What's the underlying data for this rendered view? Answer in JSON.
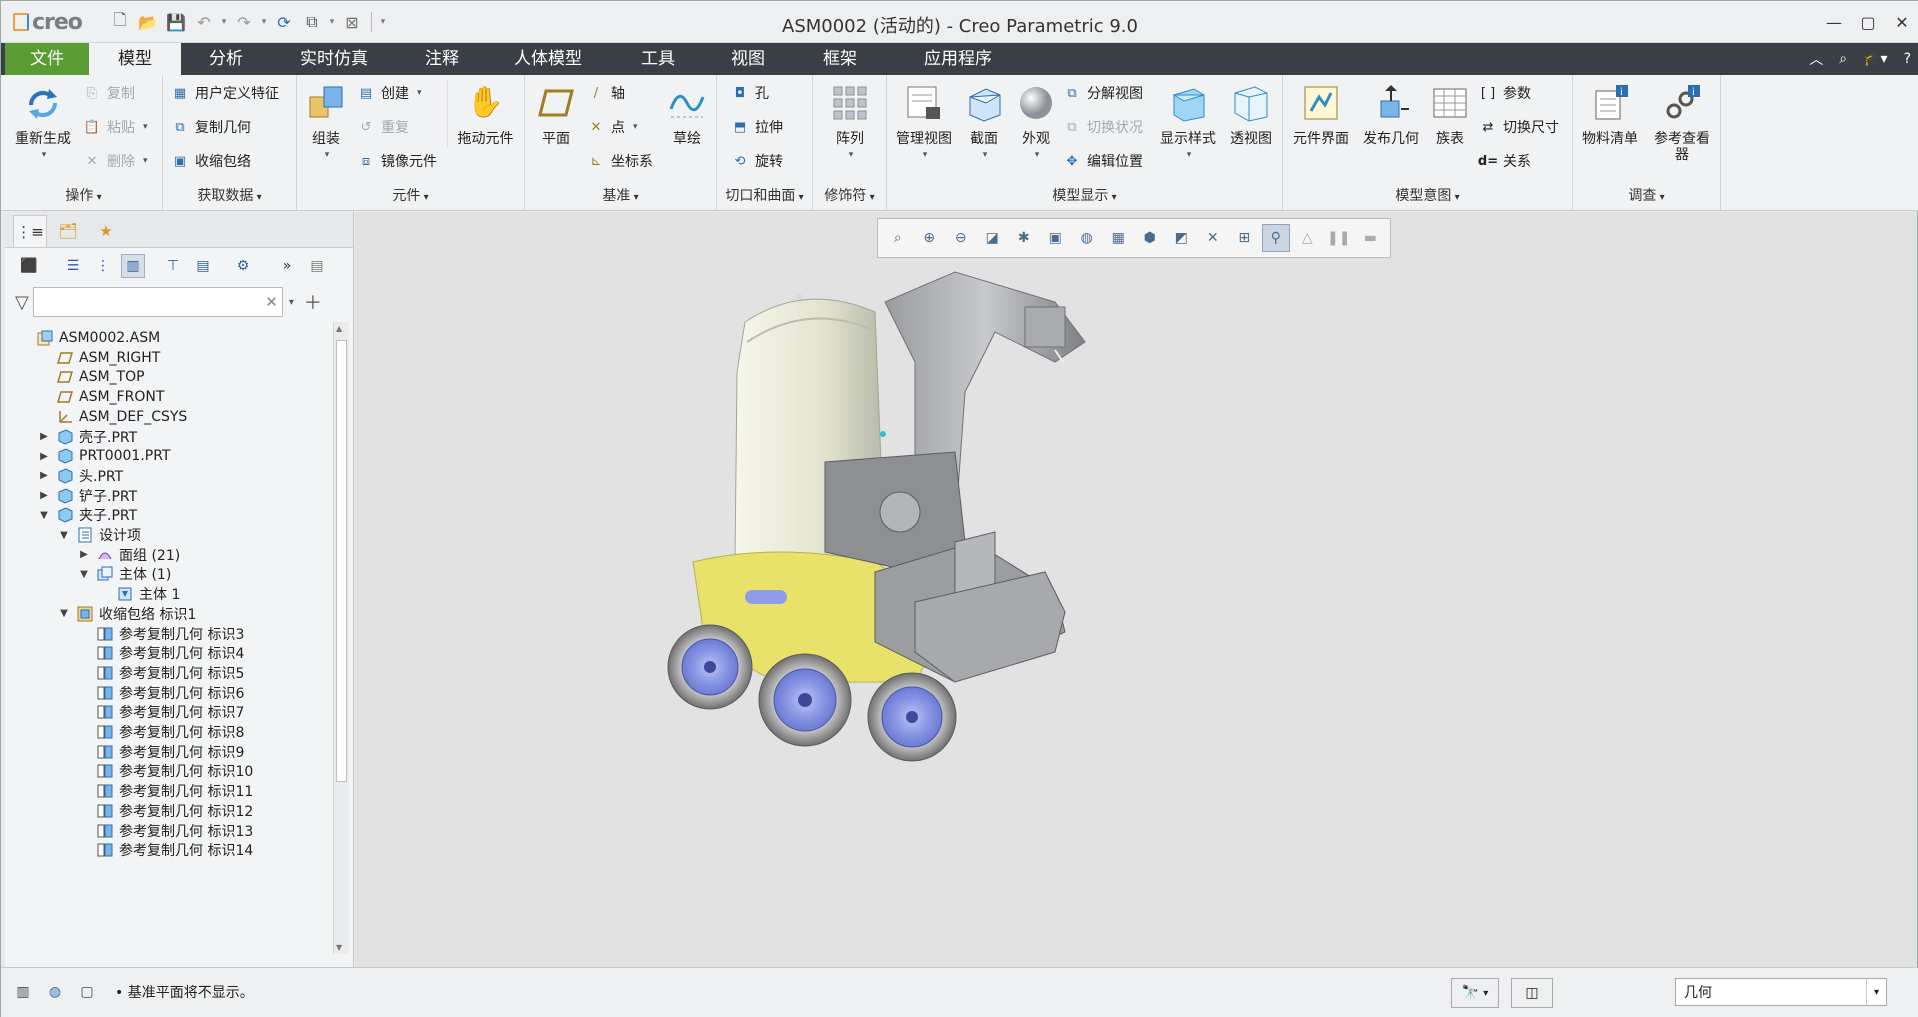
{
  "title_bar": {
    "title": "ASM0002 (活动的) - Creo Parametric 9.0",
    "logo_text": "creo",
    "qat_icons": [
      "new-icon",
      "open-icon",
      "save-icon",
      "undo-icon",
      "redo-icon",
      "regenerate-icon",
      "windows-icon",
      "close-window-icon",
      "customize-icon"
    ]
  },
  "menu_tabs": [
    {
      "label": "文件"
    },
    {
      "label": "模型"
    },
    {
      "label": "分析"
    },
    {
      "label": "实时仿真"
    },
    {
      "label": "注释"
    },
    {
      "label": "人体模型"
    },
    {
      "label": "工具"
    },
    {
      "label": "视图"
    },
    {
      "label": "框架"
    },
    {
      "label": "应用程序"
    }
  ],
  "ribbon": {
    "operations": {
      "label": "操作",
      "regenerate": "重新生成",
      "copy": "复制",
      "paste": "粘贴",
      "delete": "删除"
    },
    "get_data": {
      "label": "获取数据",
      "udf": "用户定义特征",
      "copy_geom": "复制几何",
      "shrinkwrap": "收缩包络"
    },
    "component": {
      "label": "元件",
      "assemble": "组装",
      "create": "创建",
      "repeat": "重复",
      "mirror": "镜像元件",
      "drag": "拖动元件"
    },
    "datum": {
      "label": "基准",
      "plane": "平面",
      "axis": "轴",
      "point": "点",
      "csys": "坐标系",
      "sketch": "草绘"
    },
    "cut_surface": {
      "label": "切口和曲面",
      "hole": "孔",
      "extrude": "拉伸",
      "revolve": "旋转"
    },
    "modifiers": {
      "label": "修饰符",
      "pattern": "阵列"
    },
    "model_display": {
      "label": "模型显示",
      "manage_views": "管理视图",
      "section": "截面",
      "appearance": "外观",
      "explode": "分解视图",
      "toggle_status": "切换状况",
      "edit_position": "编辑位置",
      "display_style": "显示样式",
      "perspective": "透视图"
    },
    "model_intent": {
      "label": "模型意图",
      "comp_interface": "元件界面",
      "publish_geom": "发布几何",
      "family_table": "族表",
      "params": "参数",
      "switch_dims": "切换尺寸",
      "relations": "关系"
    },
    "investigate": {
      "label": "调查",
      "bom": "物料清单",
      "ref_viewer": "参考查看器"
    }
  },
  "model_tree": {
    "filter_placeholder": "",
    "rows": [
      {
        "label": "ASM0002.ASM",
        "depth": 0,
        "expander": "",
        "icon": "assembly-icon"
      },
      {
        "label": "ASM_RIGHT",
        "depth": 1,
        "expander": "",
        "icon": "datum-plane-icon"
      },
      {
        "label": "ASM_TOP",
        "depth": 1,
        "expander": "",
        "icon": "datum-plane-icon"
      },
      {
        "label": "ASM_FRONT",
        "depth": 1,
        "expander": "",
        "icon": "datum-plane-icon"
      },
      {
        "label": "ASM_DEF_CSYS",
        "depth": 1,
        "expander": "",
        "icon": "csys-icon"
      },
      {
        "label": "壳子.PRT",
        "depth": 1,
        "expander": "▶",
        "icon": "part-icon"
      },
      {
        "label": "PRT0001.PRT",
        "depth": 1,
        "expander": "▶",
        "icon": "part-icon"
      },
      {
        "label": "头.PRT",
        "depth": 1,
        "expander": "▶",
        "icon": "part-icon"
      },
      {
        "label": "铲子.PRT",
        "depth": 1,
        "expander": "▶",
        "icon": "part-icon"
      },
      {
        "label": "夹子.PRT",
        "depth": 1,
        "expander": "▼",
        "icon": "part-icon"
      },
      {
        "label": "设计项",
        "depth": 2,
        "expander": "▼",
        "icon": "design-items-icon"
      },
      {
        "label": "面组 (21)",
        "depth": 3,
        "expander": "▶",
        "icon": "quilt-icon"
      },
      {
        "label": "主体 (1)",
        "depth": 3,
        "expander": "▼",
        "icon": "body-group-icon"
      },
      {
        "label": "主体 1",
        "depth": 4,
        "expander": "",
        "icon": "body-icon"
      },
      {
        "label": "收缩包络 标识1",
        "depth": 2,
        "expander": "▼",
        "icon": "shrinkwrap-icon"
      },
      {
        "label": "参考复制几何 标识3",
        "depth": 3,
        "expander": "",
        "icon": "copy-geom-icon"
      },
      {
        "label": "参考复制几何 标识4",
        "depth": 3,
        "expander": "",
        "icon": "copy-geom-icon"
      },
      {
        "label": "参考复制几何 标识5",
        "depth": 3,
        "expander": "",
        "icon": "copy-geom-icon"
      },
      {
        "label": "参考复制几何 标识6",
        "depth": 3,
        "expander": "",
        "icon": "copy-geom-icon"
      },
      {
        "label": "参考复制几何 标识7",
        "depth": 3,
        "expander": "",
        "icon": "copy-geom-icon"
      },
      {
        "label": "参考复制几何 标识8",
        "depth": 3,
        "expander": "",
        "icon": "copy-geom-icon"
      },
      {
        "label": "参考复制几何 标识9",
        "depth": 3,
        "expander": "",
        "icon": "copy-geom-icon"
      },
      {
        "label": "参考复制几何 标识10",
        "depth": 3,
        "expander": "",
        "icon": "copy-geom-icon"
      },
      {
        "label": "参考复制几何 标识11",
        "depth": 3,
        "expander": "",
        "icon": "copy-geom-icon"
      },
      {
        "label": "参考复制几何 标识12",
        "depth": 3,
        "expander": "",
        "icon": "copy-geom-icon"
      },
      {
        "label": "参考复制几何 标识13",
        "depth": 3,
        "expander": "",
        "icon": "copy-geom-icon"
      },
      {
        "label": "参考复制几何 标识14",
        "depth": 3,
        "expander": "",
        "icon": "copy-geom-icon"
      }
    ]
  },
  "status": {
    "message": "基准平面将不显示。",
    "selection_filter": "几何"
  },
  "colors": {
    "file_tab": "#5a9c34",
    "tabbar": "#3a3f45",
    "model_yellow": "#e8e26a",
    "wheel_blue": "#9aa6f0"
  }
}
